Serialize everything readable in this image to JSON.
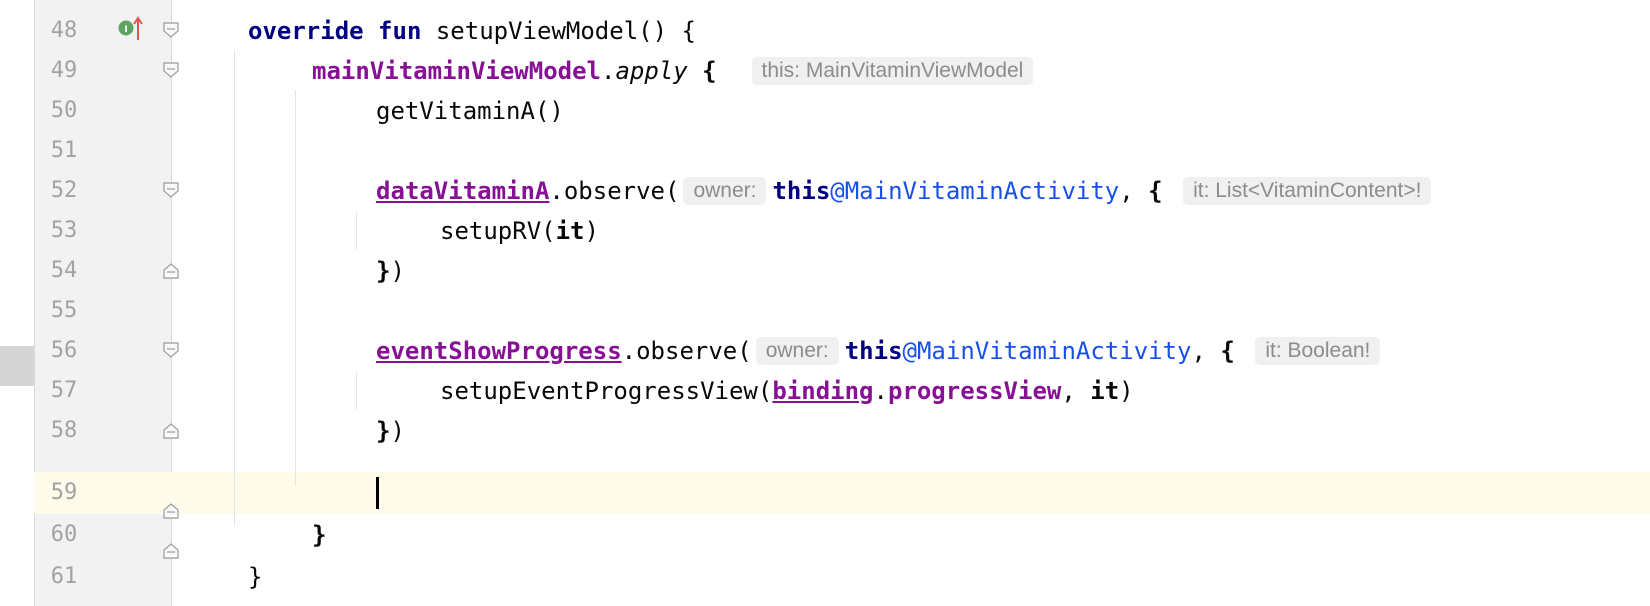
{
  "lines": [
    {
      "num": "48"
    },
    {
      "num": "49"
    },
    {
      "num": "50"
    },
    {
      "num": "51"
    },
    {
      "num": "52"
    },
    {
      "num": "53"
    },
    {
      "num": "54"
    },
    {
      "num": "55"
    },
    {
      "num": "56"
    },
    {
      "num": "57"
    },
    {
      "num": "58"
    },
    {
      "num": "59"
    },
    {
      "num": "60"
    },
    {
      "num": "61"
    }
  ],
  "code": {
    "l48": {
      "override": "override",
      "fun": "fun",
      "rest": " setupViewModel() {"
    },
    "l49": {
      "obj": "mainVitaminViewModel",
      "dot": ".",
      "apply": "apply",
      "brace": " {",
      "hint": "this: MainVitaminViewModel"
    },
    "l50": {
      "text": "getVitaminA()"
    },
    "l52": {
      "obj": "dataVitaminA",
      "call": ".observe(",
      "owner_hint": "owner:",
      "this": "this",
      "label": "@MainVitaminActivity",
      "sep": ", ",
      "brace": "{",
      "it_hint": "it: List<VitaminContent>!"
    },
    "l53": {
      "call": "setupRV(",
      "it": "it",
      "close": ")"
    },
    "l54": {
      "brace": "}",
      "paren": ")"
    },
    "l56": {
      "obj": "eventShowProgress",
      "call": ".observe(",
      "owner_hint": "owner:",
      "this": "this",
      "label": "@MainVitaminActivity",
      "sep": ", ",
      "brace": "{",
      "it_hint": "it: Boolean!"
    },
    "l57": {
      "call": "setupEventProgressView(",
      "binding": "binding",
      "dot": ".",
      "prop": "progressView",
      "sep": ", ",
      "it": "it",
      "close": ")"
    },
    "l58": {
      "brace": "}",
      "paren": ")"
    },
    "l60": {
      "brace": "}"
    },
    "l61": {
      "brace": "}"
    }
  },
  "gutter": {
    "implements_icon": "implements-method-icon",
    "implements_letter": "I"
  },
  "colors": {
    "keyword": "#0033b3",
    "property": "#871094",
    "label": "#1750eb",
    "current_line": "#fefbea"
  }
}
